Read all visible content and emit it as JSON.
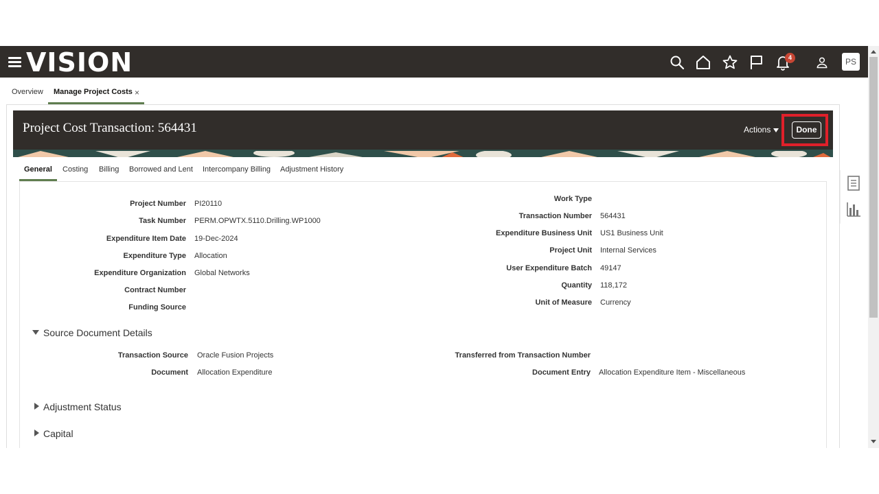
{
  "app": {
    "logo": "VISION",
    "notification_count": "4",
    "avatar_initials": "PS"
  },
  "page_tabs": [
    {
      "label": "Overview"
    },
    {
      "label": "Manage Project Costs"
    }
  ],
  "page_tab_close": "×",
  "header": {
    "title": "Project Cost Transaction: 564431",
    "actions_label": "Actions",
    "done_label": "Done"
  },
  "sub_tabs": [
    {
      "label": "General"
    },
    {
      "label": "Costing"
    },
    {
      "label": "Billing"
    },
    {
      "label": "Borrowed and Lent"
    },
    {
      "label": "Intercompany Billing"
    },
    {
      "label": "Adjustment History"
    }
  ],
  "general_left": [
    {
      "label": "Project Number",
      "value": "PI20110"
    },
    {
      "label": "Task Number",
      "value": "PERM.OPWTX.5110.Drilling.WP1000"
    },
    {
      "label": "Expenditure Item Date",
      "value": "19-Dec-2024"
    },
    {
      "label": "Expenditure Type",
      "value": "Allocation"
    },
    {
      "label": "Expenditure Organization",
      "value": "Global Networks"
    },
    {
      "label": "Contract Number",
      "value": ""
    },
    {
      "label": "Funding Source",
      "value": ""
    }
  ],
  "general_right": [
    {
      "label": "Work Type",
      "value": ""
    },
    {
      "label": "Transaction Number",
      "value": "564431"
    },
    {
      "label": "Expenditure Business Unit",
      "value": "US1 Business Unit"
    },
    {
      "label": "Project Unit",
      "value": "Internal Services"
    },
    {
      "label": "User Expenditure Batch",
      "value": "49147"
    },
    {
      "label": "Quantity",
      "value": "118,172"
    },
    {
      "label": "Unit of Measure",
      "value": "Currency"
    }
  ],
  "source_section": {
    "title": "Source Document Details",
    "left": [
      {
        "label": "Transaction Source",
        "value": "Oracle Fusion Projects"
      },
      {
        "label": "Document",
        "value": "Allocation Expenditure"
      }
    ],
    "right": [
      {
        "label": "Transferred from Transaction Number",
        "value": ""
      },
      {
        "label": "Document Entry",
        "value": "Allocation Expenditure Item - Miscellaneous"
      }
    ]
  },
  "collapsed_sections": [
    {
      "title": "Adjustment Status"
    },
    {
      "title": "Capital"
    }
  ],
  "colors": {
    "topbar": "#312d2a",
    "accent_tab": "#5f7d4f",
    "highlight": "#e0202a",
    "badge": "#c74634"
  }
}
